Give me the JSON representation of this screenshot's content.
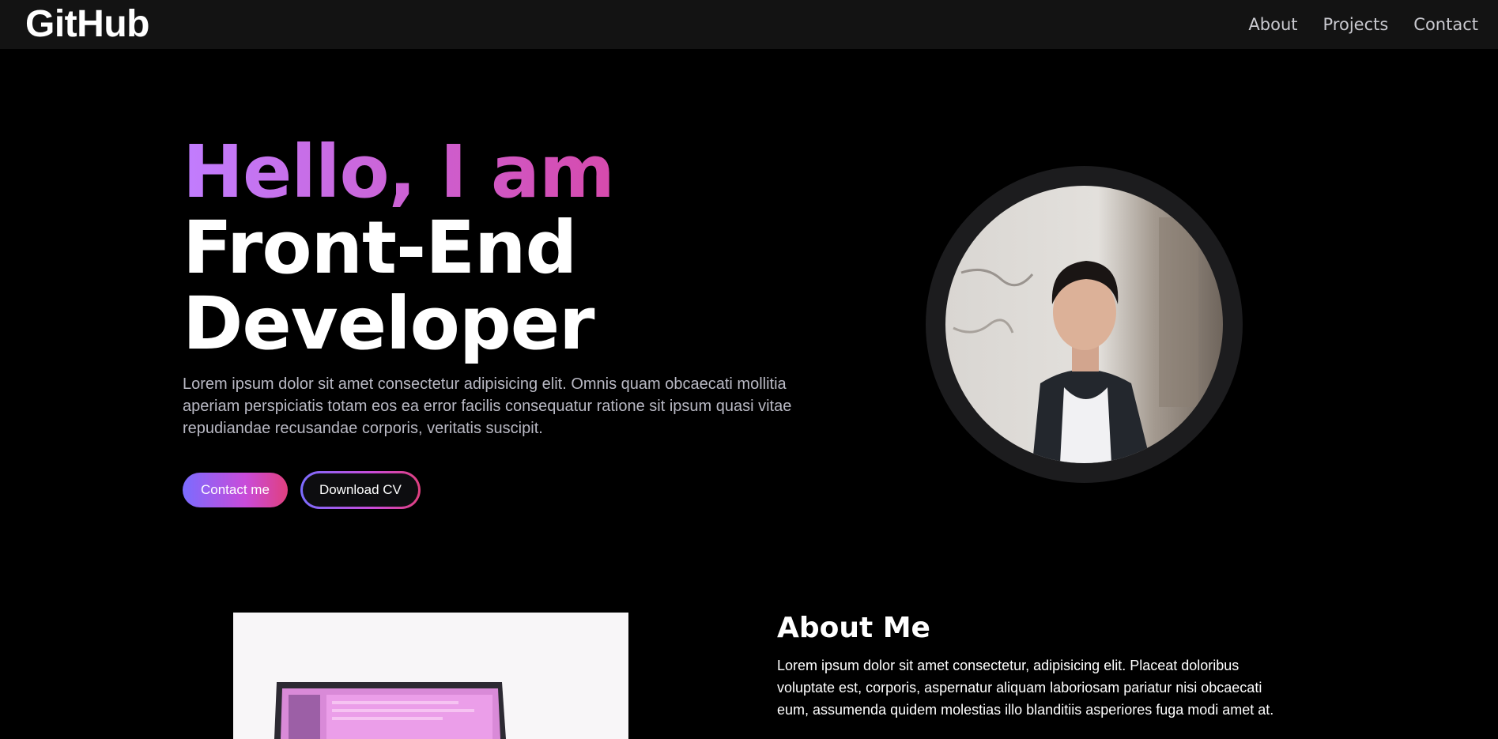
{
  "navbar": {
    "logo": "GitHub",
    "links": [
      "About",
      "Projects",
      "Contact"
    ]
  },
  "hero": {
    "greeting": "Hello, I am",
    "title_line1": "Front-End",
    "title_line2": "Developer",
    "description": "Lorem ipsum dolor sit amet consectetur adipisicing elit. Omnis quam obcaecati mollitia aperiam perspiciatis totam eos ea error facilis consequatur ratione sit ipsum quasi vitae repudiandae recusandae corporis, veritatis suscipit.",
    "contact_button": "Contact me",
    "download_button": "Download CV"
  },
  "about": {
    "title": "About Me",
    "text": "Lorem ipsum dolor sit amet consectetur, adipisicing elit. Placeat doloribus voluptate est, corporis, aspernatur aliquam laboriosam pariatur nisi obcaecati eum, assumenda quidem molestias illo blanditiis asperiores fuga modi amet at."
  },
  "colors": {
    "background": "#000000",
    "navbar": "#131313",
    "gradient_start": "#c17dff",
    "gradient_end": "#e0337f",
    "muted_text": "#b9b9c4"
  }
}
